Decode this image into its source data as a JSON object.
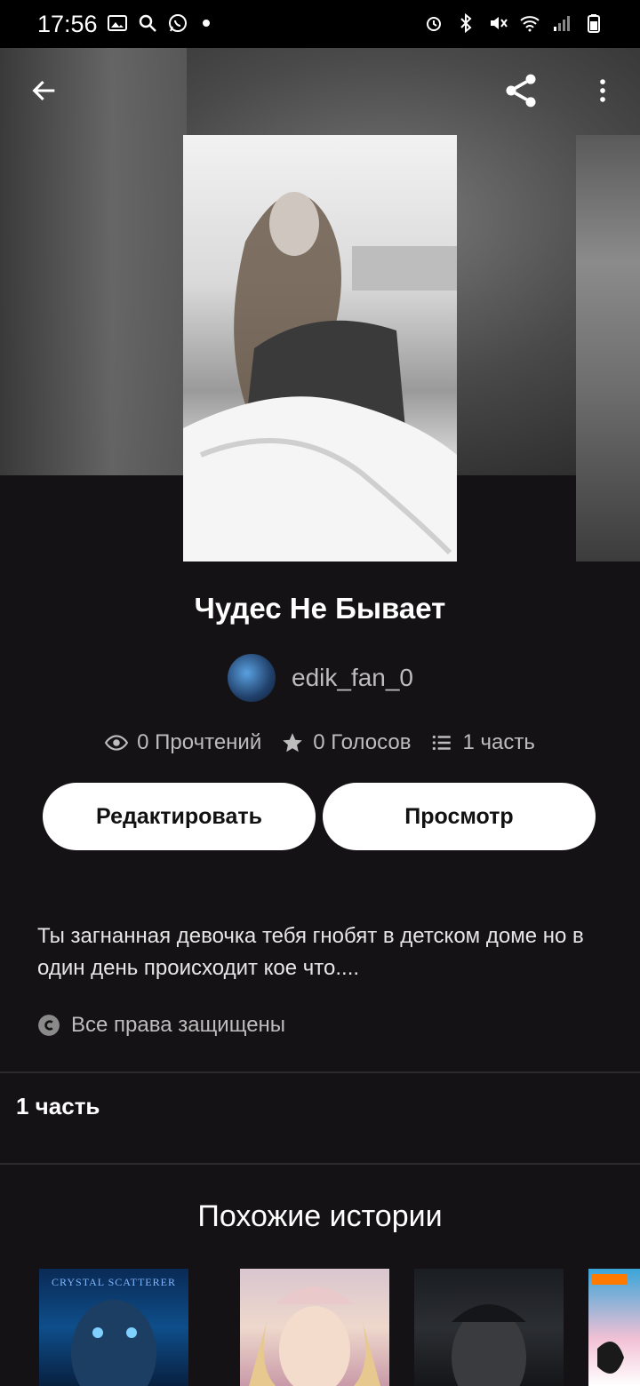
{
  "status_bar": {
    "time": "17:56"
  },
  "story": {
    "title": "Чудес Не Бывает",
    "author": "edik_fan_0",
    "reads": "0 Прочтений",
    "votes": "0 Голосов",
    "parts": "1 часть",
    "description": "Ты загнанная девочка тебя гнобят в детском доме но в один день происходит кое что....",
    "rights": "Все права защищены"
  },
  "actions": {
    "edit_label": "Редактировать",
    "view_label": "Просмотр"
  },
  "parts_section": {
    "label": "1 часть"
  },
  "similar": {
    "title": "Похожие истории",
    "cover_texts": [
      "CRYSTAL SCATTERER",
      "",
      "",
      ""
    ]
  },
  "colors": {
    "background": "#141214",
    "button_bg": "#ffffff",
    "muted_text": "#bdbdbd"
  }
}
